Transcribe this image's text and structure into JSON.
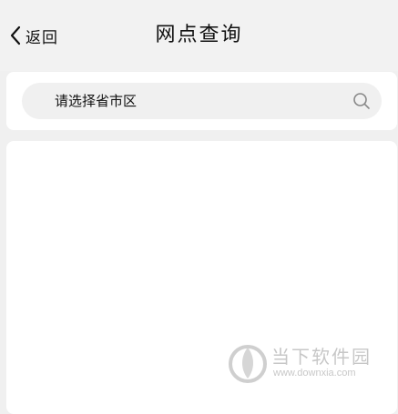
{
  "nav": {
    "back_label": "返回",
    "title": "网点查询"
  },
  "search": {
    "placeholder": "请选择省市区",
    "icon": "search-icon"
  },
  "watermark": {
    "title": "当下软件园",
    "url": "www.downxia.com"
  }
}
